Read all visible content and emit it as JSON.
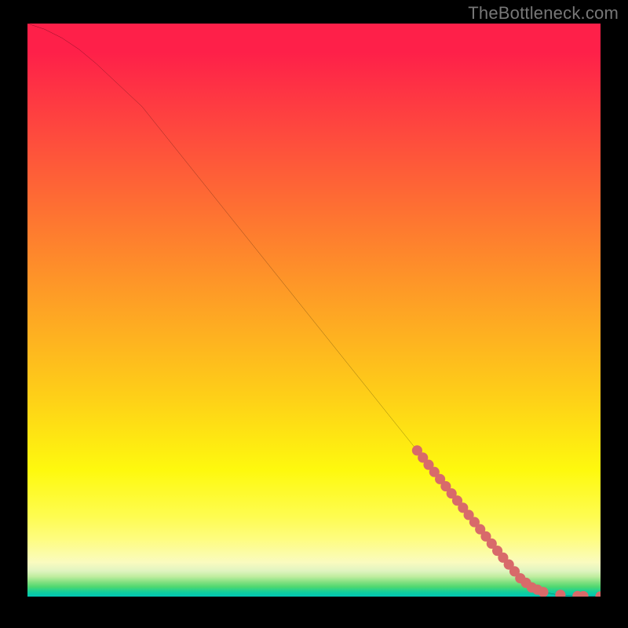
{
  "attribution": "TheBottleneck.com",
  "chart_data": {
    "type": "line",
    "title": "",
    "xlabel": "",
    "ylabel": "",
    "xlim": [
      0,
      100
    ],
    "ylim": [
      0,
      100
    ],
    "series": [
      {
        "name": "bottleneck-curve",
        "x": [
          0,
          3,
          6,
          9,
          12,
          20,
          30,
          40,
          50,
          60,
          68,
          76,
          82,
          86,
          88,
          90,
          92,
          94,
          96,
          98,
          100
        ],
        "y": [
          100,
          99,
          97.5,
          95.5,
          93,
          85.5,
          73,
          60.5,
          48,
          35.5,
          25.5,
          15.5,
          8,
          3.2,
          1.6,
          0.8,
          0.4,
          0.2,
          0.1,
          0.05,
          0.03
        ]
      }
    ],
    "markers": [
      {
        "x": 68,
        "y": 25.5
      },
      {
        "x": 69,
        "y": 24.25
      },
      {
        "x": 70,
        "y": 23.0
      },
      {
        "x": 71,
        "y": 21.75
      },
      {
        "x": 72,
        "y": 20.5
      },
      {
        "x": 73,
        "y": 19.25
      },
      {
        "x": 74,
        "y": 18.0
      },
      {
        "x": 75,
        "y": 16.75
      },
      {
        "x": 76,
        "y": 15.5
      },
      {
        "x": 77,
        "y": 14.25
      },
      {
        "x": 78,
        "y": 13.0
      },
      {
        "x": 79,
        "y": 11.75
      },
      {
        "x": 80,
        "y": 10.5
      },
      {
        "x": 81,
        "y": 9.25
      },
      {
        "x": 82,
        "y": 8.0
      },
      {
        "x": 83,
        "y": 6.8
      },
      {
        "x": 84,
        "y": 5.6
      },
      {
        "x": 85,
        "y": 4.4
      },
      {
        "x": 86,
        "y": 3.2
      },
      {
        "x": 87,
        "y": 2.4
      },
      {
        "x": 88,
        "y": 1.6
      },
      {
        "x": 89,
        "y": 1.2
      },
      {
        "x": 90,
        "y": 0.8
      },
      {
        "x": 93,
        "y": 0.3
      },
      {
        "x": 96,
        "y": 0.1
      },
      {
        "x": 97,
        "y": 0.08
      },
      {
        "x": 100,
        "y": 0.03
      }
    ],
    "colors": {
      "curve": "#000000",
      "marker": "#D86A6A"
    }
  }
}
